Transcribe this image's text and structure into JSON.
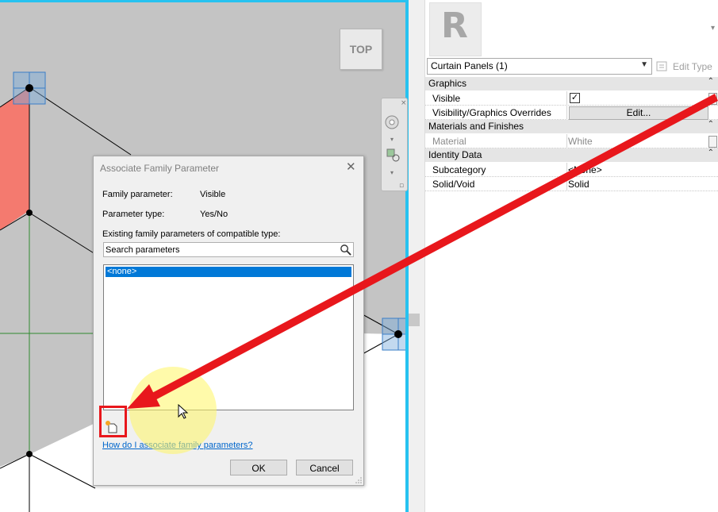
{
  "viewcube": {
    "label": "TOP"
  },
  "properties": {
    "logo_letter": "R",
    "type_selector": "Curtain Panels (1)",
    "edit_type_label": "Edit Type",
    "sections": [
      {
        "title": "Graphics",
        "rows": [
          {
            "label": "Visible",
            "value": "",
            "checked": true
          },
          {
            "label": "Visibility/Graphics Overrides",
            "value": "Edit..."
          }
        ]
      },
      {
        "title": "Materials and Finishes",
        "rows": [
          {
            "label": "Material",
            "value": "White"
          }
        ]
      },
      {
        "title": "Identity Data",
        "rows": [
          {
            "label": "Subcategory",
            "value": "<None>"
          },
          {
            "label": "Solid/Void",
            "value": "Solid"
          }
        ]
      }
    ]
  },
  "dialog": {
    "title": "Associate Family Parameter",
    "family_parameter_label": "Family parameter:",
    "family_parameter_value": "Visible",
    "parameter_type_label": "Parameter type:",
    "parameter_type_value": "Yes/No",
    "existing_label": "Existing family parameters of compatible type:",
    "search_placeholder": "Search parameters",
    "list_items": [
      "<none>"
    ],
    "help_link": "How do I associate family parameters?",
    "ok_label": "OK",
    "cancel_label": "Cancel"
  },
  "colors": {
    "viewport_bg": "#c4c4c4",
    "active_view_border": "#27c2f0",
    "annotation_red": "#e8171c",
    "selection_blue": "#0078d7",
    "panel_fill": "#f47a6f"
  }
}
